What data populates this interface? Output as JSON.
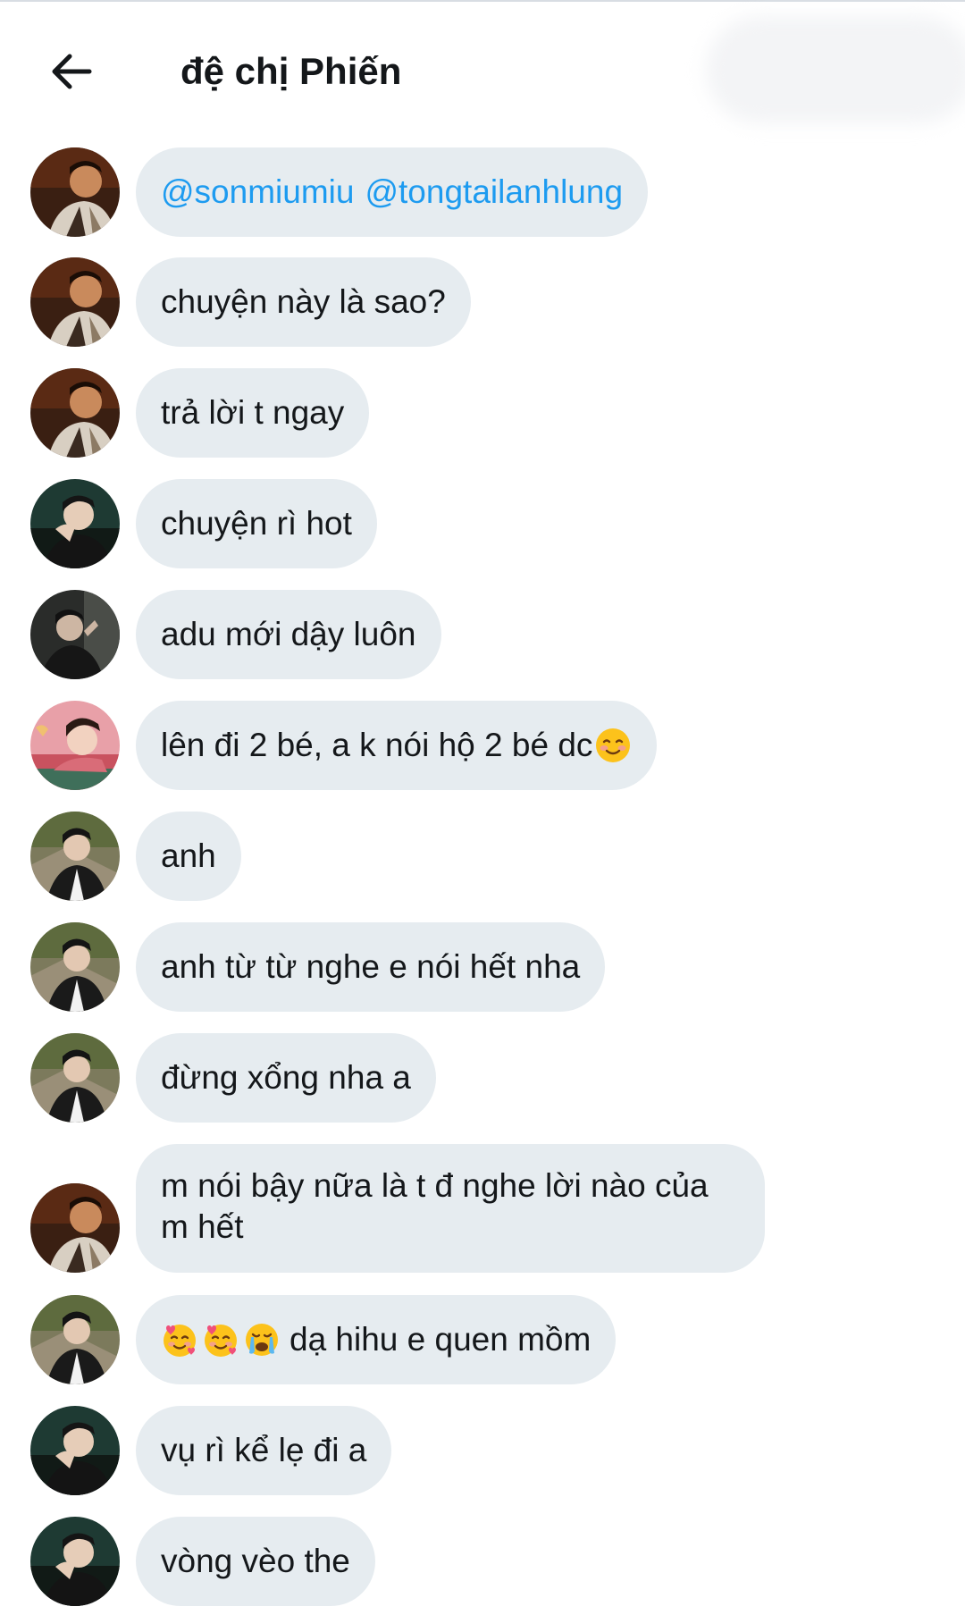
{
  "header": {
    "title": "đệ chị Phiến",
    "back_icon": "arrow-left-icon"
  },
  "messages": [
    {
      "avatar": "a",
      "mentions": [
        "@sonmiumiu",
        "@tongtailanhlung"
      ]
    },
    {
      "avatar": "a",
      "text": "chuyện này là sao?"
    },
    {
      "avatar": "a",
      "text": "trả lời t ngay"
    },
    {
      "avatar": "b",
      "text": "chuyện rì hot"
    },
    {
      "avatar": "c",
      "text": "adu mới dậy luôn"
    },
    {
      "avatar": "d",
      "text": "lên đi 2 bé, a k nói hộ 2 bé dc",
      "emoji_after": "smiling-blush-emoji"
    },
    {
      "avatar": "e",
      "text": "anh"
    },
    {
      "avatar": "e",
      "text": "anh từ từ nghe e nói hết nha"
    },
    {
      "avatar": "e",
      "text": "đừng xổng nha a"
    },
    {
      "avatar": "a",
      "text": "m nói bậy nữa là t đ nghe lời nào của m hết"
    },
    {
      "avatar": "e",
      "emojis_before": [
        "smiling-hearts-emoji",
        "smiling-hearts-emoji",
        "crying-emoji"
      ],
      "text": "dạ hihu e quen mồm"
    },
    {
      "avatar": "b",
      "text": "vụ rì kể lẹ đi a"
    },
    {
      "avatar": "b",
      "text": "vòng vèo the"
    }
  ],
  "colors": {
    "bubble": "#e6ecf0",
    "text": "#14171a",
    "mention": "#1d9bf0"
  }
}
